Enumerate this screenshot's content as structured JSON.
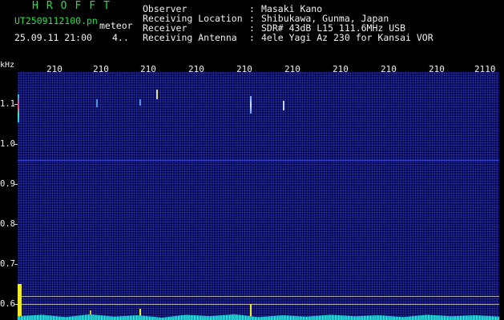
{
  "header": {
    "title": "HROFFT",
    "file_name": "UT2509112100.pn",
    "meteor_tag": "meteor",
    "date_time": "25.09.11 21:00",
    "count": "4..",
    "info_labels": [
      "Observer",
      "Receiving Location",
      "Receiver",
      "Receiving Antenna"
    ],
    "info_sep": ":",
    "info_values": [
      "Masaki Kano",
      "Shibukawa, Gunma, Japan",
      "SDR# 43dB L15 111.6MHz USB",
      "4ele Yagi Az 230 for Kansai VOR"
    ]
  },
  "axis": {
    "y_unit": "kHz",
    "y_ticks": [
      "1.1",
      "1.0",
      "0.9",
      "0.8",
      "0.7",
      "0.6"
    ],
    "x_ticks": [
      "210",
      "210",
      "210",
      "210",
      "210",
      "210",
      "210",
      "210",
      "210",
      "210",
      "2110"
    ]
  },
  "colors": {
    "background": "#000000",
    "title_green": "#25e04a",
    "text_white": "#f0f0f0",
    "spectrum_blue": "#0a0c55",
    "cursor_line": "#b0b0b0",
    "echo": "#f0ea20"
  }
}
